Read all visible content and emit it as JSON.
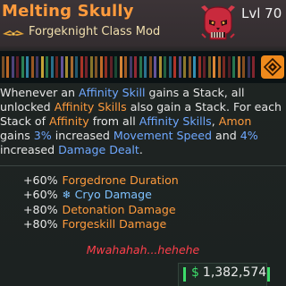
{
  "item": {
    "name": "Melting Skully",
    "type": "Forgeknight Class Mod",
    "level_text": "Lvl 70",
    "manufacturer_icon": "skull-logo-icon",
    "subtype_icon": "wings-icon",
    "element_icon": "element-diamond-icon"
  },
  "description": {
    "p1": "Whenever an ",
    "h1": "Affinity Skill",
    "p2": " gains a Stack, all unlocked ",
    "h2": "Affinity Skills",
    "p3": " also gain a Stack. For each Stack of ",
    "h3": "Affinity",
    "p4": " from all ",
    "h4": "Affinity Skills",
    "p5": ", ",
    "h5": "Amon",
    "p6": " gains ",
    "h6": "3%",
    "p7": " increased ",
    "h7": "Movement Speed",
    "p8": " and ",
    "h8": "4%",
    "p9": " increased ",
    "h9": "Damage Dealt",
    "p10": "."
  },
  "stats": [
    {
      "value": "+60%",
      "name": "Forgedrone Duration",
      "icon": ""
    },
    {
      "value": "+60%",
      "name": "Cryo Damage",
      "icon": "snowflake-icon"
    },
    {
      "value": "+80%",
      "name": "Detonation Damage",
      "icon": ""
    },
    {
      "value": "+80%",
      "name": "Forgeskill Damage",
      "icon": ""
    }
  ],
  "flavor_text": "Mwahahah...hehehe",
  "price": {
    "currency": "$",
    "amount": "1,382,574"
  },
  "colors": {
    "rarity_orange": "#ff9b3d",
    "skill_blue": "#6fa8ff",
    "cryo_blue": "#7ec2ff",
    "flavor_red": "#ff3f4b",
    "money_green": "#3ddc6a"
  }
}
